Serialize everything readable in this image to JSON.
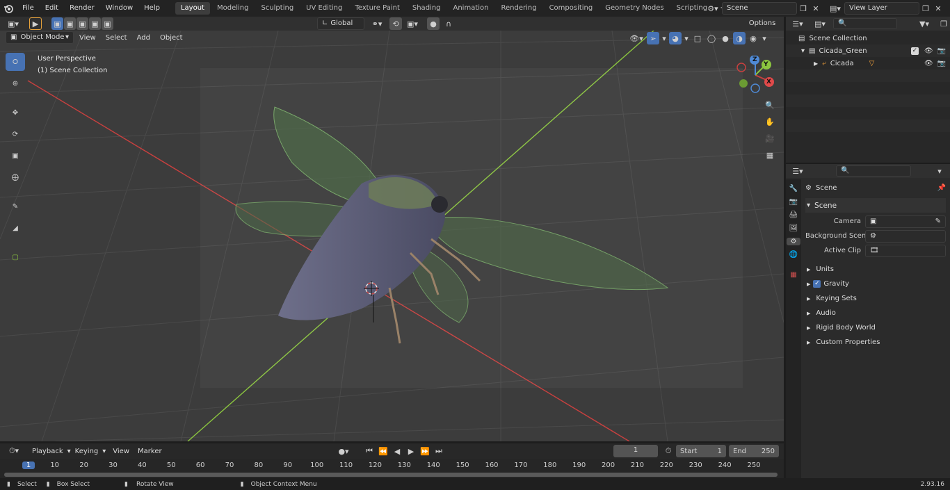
{
  "menu": [
    "File",
    "Edit",
    "Render",
    "Window",
    "Help"
  ],
  "workspaces": [
    {
      "label": "Layout",
      "active": true
    },
    {
      "label": "Modeling",
      "active": false
    },
    {
      "label": "Sculpting",
      "active": false
    },
    {
      "label": "UV Editing",
      "active": false
    },
    {
      "label": "Texture Paint",
      "active": false
    },
    {
      "label": "Shading",
      "active": false
    },
    {
      "label": "Animation",
      "active": false
    },
    {
      "label": "Rendering",
      "active": false
    },
    {
      "label": "Compositing",
      "active": false
    },
    {
      "label": "Geometry Nodes",
      "active": false
    },
    {
      "label": "Scripting",
      "active": false
    }
  ],
  "add_tab_symbol": "+",
  "scene_selector": {
    "value": "Scene"
  },
  "view_layer_selector": {
    "value": "View Layer"
  },
  "viewport_header": {
    "mode": "Object Mode",
    "menus": [
      "View",
      "Select",
      "Add",
      "Object"
    ],
    "orientation": "Global",
    "options": "Options"
  },
  "viewport_overlay": {
    "line1": "User Perspective",
    "line2": "(1) Scene Collection"
  },
  "gizmo": {
    "x": "X",
    "y": "Y",
    "z": "Z"
  },
  "outliner": {
    "root": "Scene Collection",
    "collection": "Cicada_Green",
    "object": "Cicada"
  },
  "properties": {
    "header": "Scene",
    "panel": "Scene",
    "camera_label": "Camera",
    "background_label": "Background Scene",
    "active_clip_label": "Active Clip",
    "subpanels": [
      "Units",
      "Gravity",
      "Keying Sets",
      "Audio",
      "Rigid Body World",
      "Custom Properties"
    ],
    "gravity_checked": true
  },
  "timeline": {
    "menus": [
      "Playback",
      "Keying",
      "View",
      "Marker"
    ],
    "current_frame": "1",
    "start_label": "Start",
    "start_value": "1",
    "end_label": "End",
    "end_value": "250",
    "ticks": [
      "1",
      "10",
      "20",
      "30",
      "40",
      "50",
      "60",
      "70",
      "80",
      "90",
      "100",
      "110",
      "120",
      "130",
      "140",
      "150",
      "160",
      "170",
      "180",
      "190",
      "200",
      "210",
      "220",
      "230",
      "240",
      "250"
    ]
  },
  "statusbar": {
    "select": "Select",
    "box_select": "Box Select",
    "rotate_view": "Rotate View",
    "context_menu": "Object Context Menu",
    "version": "2.93.16"
  },
  "colors": {
    "accent": "#4772b3",
    "x_axis": "#c8403f",
    "y_axis": "#8bc53f",
    "viewport_bg": "#3c3c3c",
    "origin": "#f4a23a"
  }
}
